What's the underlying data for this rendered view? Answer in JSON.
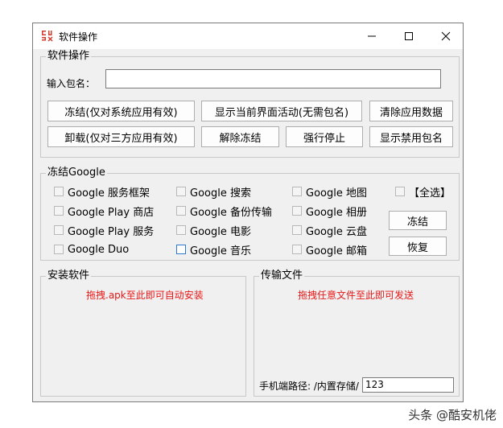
{
  "window": {
    "title": "软件操作",
    "icon": "app-logo-icon"
  },
  "package_group": {
    "legend": "软件操作",
    "input_label": "输入包名：",
    "input_value": "",
    "buttons": {
      "freeze_system": "冻结(仅对系统应用有效)",
      "show_activity": "显示当前界面活动(无需包名)",
      "clear_data": "清除应用数据",
      "uninstall_third": "卸载(仅对三方应用有效)",
      "unfreeze": "解除冻结",
      "force_stop": "强行停止",
      "show_disabled": "显示禁用包名"
    }
  },
  "google_group": {
    "legend": "冻结Google",
    "items": [
      "Google 服务框架",
      "Google 搜索",
      "Google 地图",
      "Google Play 商店",
      "Google 备份传输",
      "Google 相册",
      "Google Play 服务",
      "Google 电影",
      "Google 云盘",
      "Google Duo",
      "Google 音乐",
      "Google 邮箱"
    ],
    "select_all": "【全选】",
    "freeze_button": "冻结",
    "restore_button": "恢复"
  },
  "install_group": {
    "legend": "安装软件",
    "hint": "拖拽.apk至此即可自动安装",
    "hint_color": "#e81818"
  },
  "transfer_group": {
    "legend": "传输文件",
    "hint": "拖拽任意文件至此即可发送",
    "path_label": "手机端路径: /内置存储/",
    "path_value": "123"
  },
  "watermark": "头条 @酷安机佬"
}
